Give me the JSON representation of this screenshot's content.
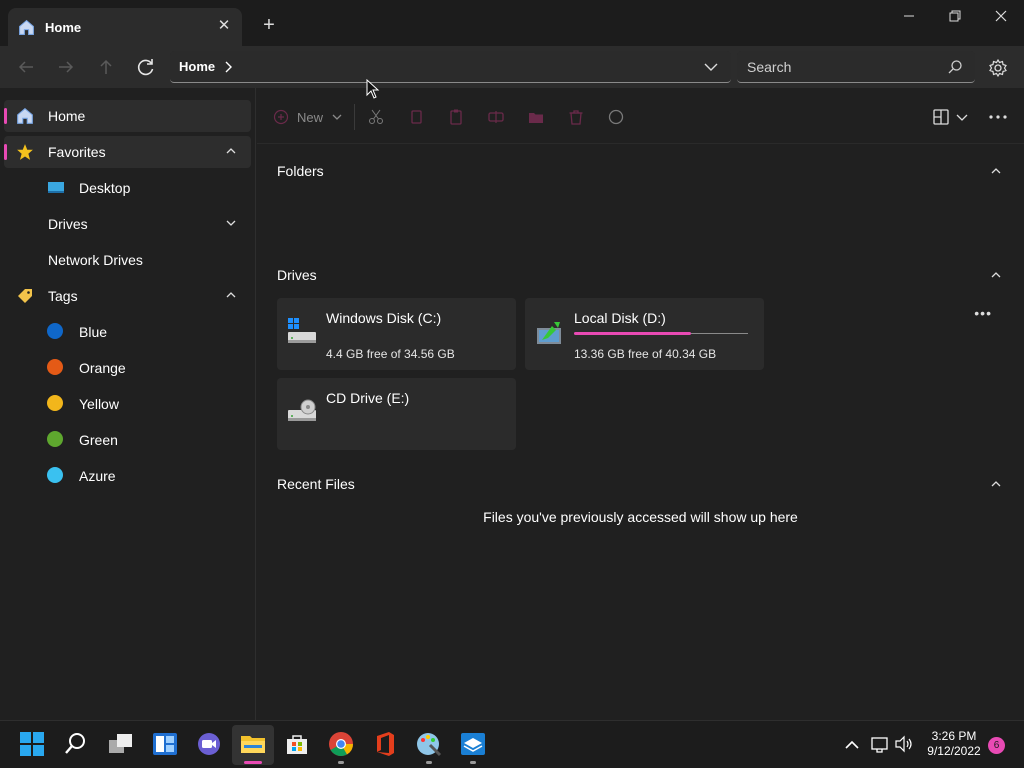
{
  "tab": {
    "title": "Home"
  },
  "address": {
    "crumb": "Home"
  },
  "search": {
    "placeholder": "Search"
  },
  "sidebar": {
    "items": [
      {
        "label": "Home"
      },
      {
        "label": "Favorites"
      },
      {
        "label": "Desktop"
      },
      {
        "label": "Drives"
      },
      {
        "label": "Network Drives"
      },
      {
        "label": "Tags"
      },
      {
        "label": "Blue",
        "color": "#0f67c9"
      },
      {
        "label": "Orange",
        "color": "#e45a16"
      },
      {
        "label": "Yellow",
        "color": "#f2b61b"
      },
      {
        "label": "Green",
        "color": "#5ea72e"
      },
      {
        "label": "Azure",
        "color": "#3ac1f0"
      }
    ]
  },
  "toolbar": {
    "new_label": "New"
  },
  "sections": {
    "folders": "Folders",
    "drives": "Drives",
    "recent": "Recent Files"
  },
  "drives": [
    {
      "name": "Windows Disk (C:)",
      "free": "4.4 GB free of 34.56 GB"
    },
    {
      "name": "Local Disk (D:)",
      "free": "13.36 GB free of 40.34 GB",
      "used_fraction": 0.67
    },
    {
      "name": "CD Drive (E:)",
      "free": ""
    }
  ],
  "recent": {
    "empty_message": "Files you've previously accessed will show up here"
  },
  "clock": {
    "time": "3:26 PM",
    "date": "9/12/2022"
  },
  "notifications": {
    "count": "6"
  },
  "accent": "#e84ab4"
}
